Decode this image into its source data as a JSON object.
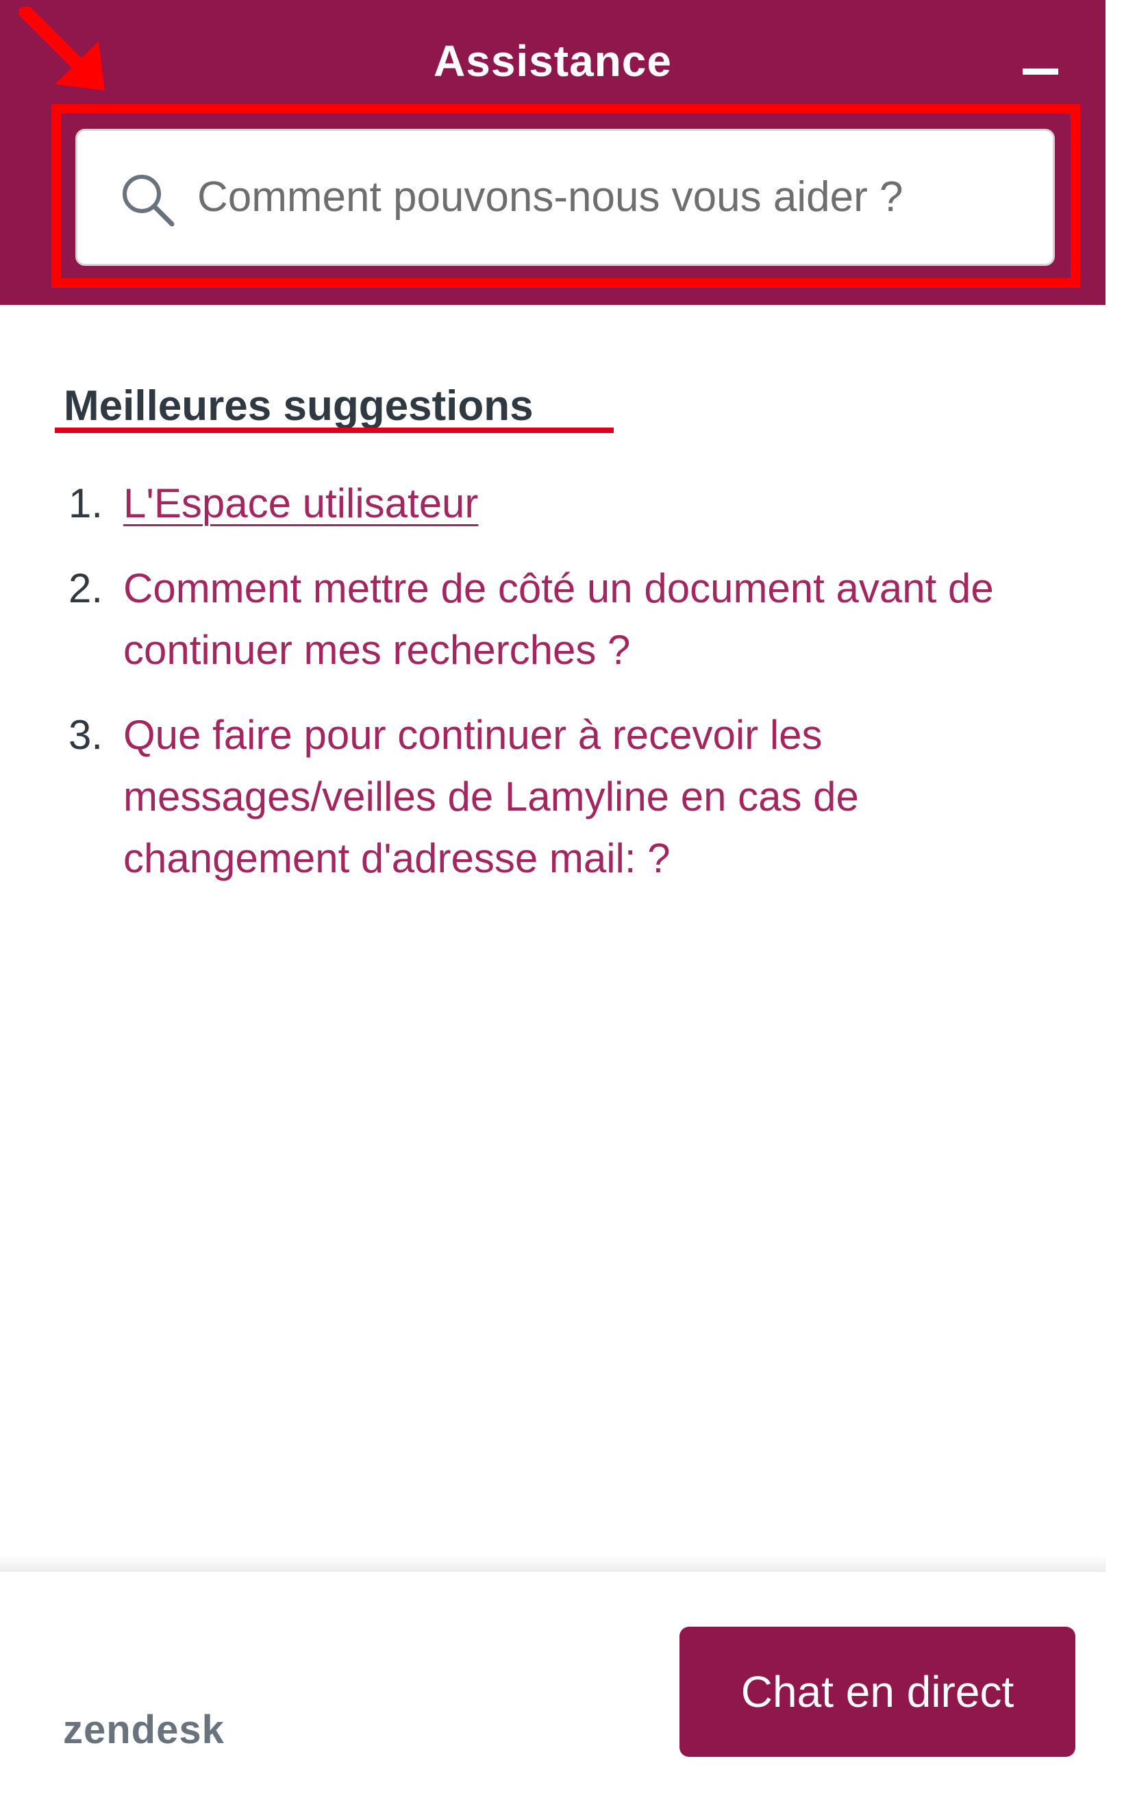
{
  "colors": {
    "brand": "#8f174c",
    "link": "#a3265e",
    "annotation": "#ff0000",
    "heading": "#2f3941"
  },
  "header": {
    "title": "Assistance",
    "minimize_icon": "minimize-icon"
  },
  "search": {
    "placeholder": "Comment pouvons-nous vous aider ?",
    "value": "",
    "icon": "search-icon"
  },
  "suggestions": {
    "title": "Meilleures suggestions",
    "items": [
      {
        "number": "1.",
        "label": "L'Espace utilisateur",
        "visited": true
      },
      {
        "number": "2.",
        "label": "Comment mettre de côté un document avant de continuer mes recherches ?",
        "visited": false
      },
      {
        "number": "3.",
        "label": "Que faire pour continuer à recevoir les messages/veilles de Lamyline en cas de changement d'adresse mail: ?",
        "visited": false
      }
    ]
  },
  "footer": {
    "branding": "zendesk",
    "chat_button_label": "Chat en direct"
  }
}
